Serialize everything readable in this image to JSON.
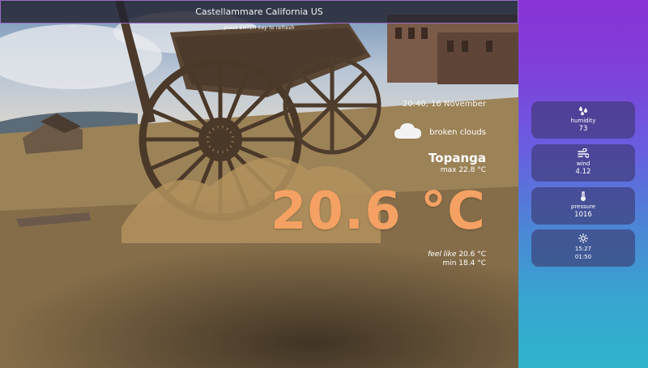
{
  "search": {
    "value": "Castellammare California US",
    "hint": "press ENTER key to refresh"
  },
  "weather": {
    "datetime": "20:40, 16 November",
    "condition": "broken clouds",
    "condition_icon": "cloud-icon",
    "city": "Topanga",
    "max": "max 22.8 °C",
    "temperature": "20.6 °C",
    "feel_label": "feel like",
    "feel_value": "20.6 °C",
    "min": "min 18.4 °C"
  },
  "panel": {
    "humidity": {
      "label": "humidity",
      "value": "73",
      "icon": "humidity-icon"
    },
    "wind": {
      "label": "wind",
      "value": "4.12",
      "icon": "wind-icon"
    },
    "pressure": {
      "label": "pressure",
      "value": "1016",
      "icon": "thermometer-icon"
    },
    "sun": {
      "sunrise": "15:27",
      "sunset": "01:50",
      "icon": "sun-icon"
    }
  },
  "colors": {
    "temperature": "#f4a163",
    "panel_top": "#8a33d6",
    "panel_bottom": "#2fb4cc"
  }
}
